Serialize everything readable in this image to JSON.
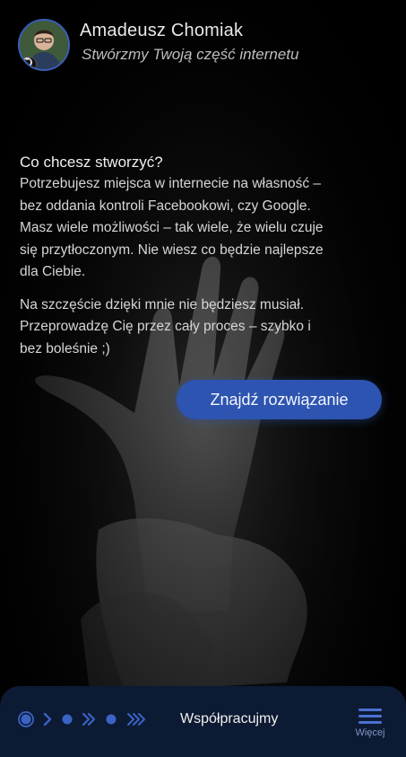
{
  "header": {
    "name": "Amadeusz Chomiak",
    "tagline": "Stwórzmy Twoją część internetu"
  },
  "main": {
    "question": "Co chcesz stworzyć?",
    "paragraph1": "Potrzebujesz miejsca w internecie na własność – bez oddania kontroli Facebookowi, czy Google. Masz wiele możliwości – tak wiele, że wielu czuje się przytłoczonym. Nie wiesz co będzie najlepsze dla Ciebie.",
    "paragraph2": "Na szczęście dzięki mnie nie będziesz musiał. Przeprowadzę Cię przez cały proces – szybko i bez boleśnie ;)",
    "cta_label": "Znajdź rozwiązanie"
  },
  "bottom_bar": {
    "section_label": "Współpracujmy",
    "menu_label": "Więcej",
    "steps": [
      "current-step",
      "arrow",
      "dot",
      "double-arrow",
      "dot",
      "triple-arrow"
    ]
  },
  "colors": {
    "accent": "#2d54b0",
    "bar_background": "#0d1a33",
    "step_color": "#3a63c4"
  }
}
